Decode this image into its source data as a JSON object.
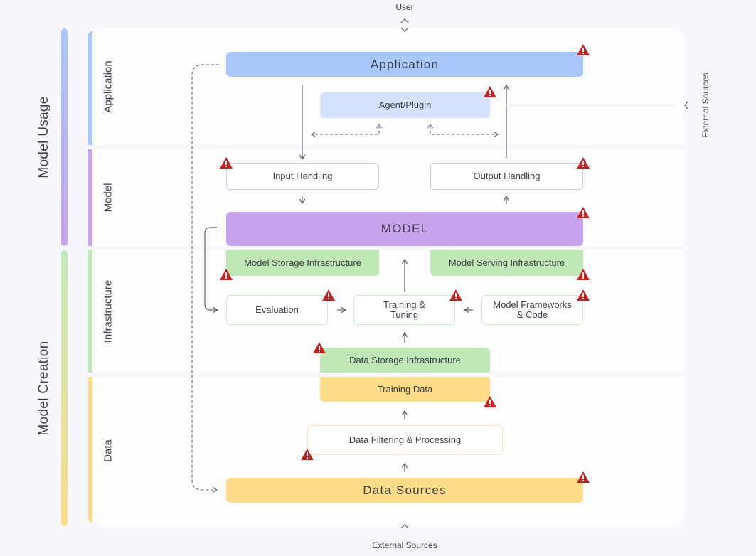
{
  "top_node": {
    "label": "User"
  },
  "bottom_node": {
    "label": "External Sources"
  },
  "right_node": {
    "label": "External Sources"
  },
  "phases": [
    {
      "label": "Model Usage",
      "color_start": "#a8c7fa",
      "color_end": "#c6a3ec"
    },
    {
      "label": "Model Creation",
      "color_start": "#c0e8b7",
      "color_end": "#fddd87"
    }
  ],
  "lanes": [
    {
      "label": "Application",
      "color": "#a8c7fa"
    },
    {
      "label": "Model",
      "color": "#c6a3ec"
    },
    {
      "label": "Infrastructure",
      "color": "#c0e8b7"
    },
    {
      "label": "Data",
      "color": "#fddd87"
    }
  ],
  "components": {
    "application": {
      "label": "Application",
      "risk": true
    },
    "agent_plugin": {
      "label": "Agent/Plugin",
      "risk": true
    },
    "input_handling": {
      "label": "Input Handling",
      "risk": true
    },
    "output_handling": {
      "label": "Output Handling",
      "risk": true
    },
    "model": {
      "label": "MODEL",
      "risk": true
    },
    "model_storage": {
      "label": "Model Storage Infrastructure",
      "risk": true
    },
    "model_serving": {
      "label": "Model Serving Infrastructure",
      "risk": true
    },
    "evaluation": {
      "label": "Evaluation",
      "risk": true
    },
    "training_tuning": {
      "label": "Training &\nTuning",
      "risk": true
    },
    "model_frameworks": {
      "label": "Model Frameworks\n& Code",
      "risk": true
    },
    "data_storage": {
      "label": "Data Storage Infrastructure",
      "risk": true
    },
    "training_data": {
      "label": "Training Data",
      "risk": true
    },
    "data_filtering": {
      "label": "Data Filtering & Processing",
      "risk": true
    },
    "data_sources": {
      "label": "Data Sources",
      "risk": true
    }
  },
  "colors": {
    "risk_icon": "#c5221f",
    "arrow": "#5f6368"
  }
}
